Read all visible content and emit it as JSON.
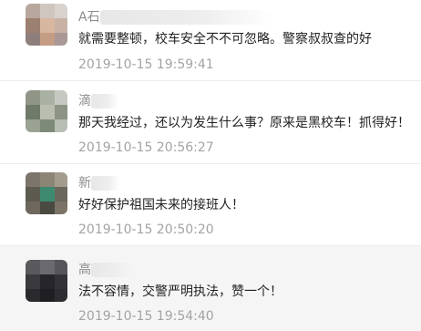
{
  "comments": [
    {
      "username": "A石",
      "text": "就需要整顿，校车安全不不可忽略。警察叔叔查的好",
      "timestamp": "2019-10-15 19:59:41"
    },
    {
      "username": "滴",
      "text": "那天我经过，还以为发生什么事？原来是黑校车！抓得好！",
      "timestamp": "2019-10-15 20:56:27"
    },
    {
      "username": "新",
      "text": "好好保护祖国未来的接班人！",
      "timestamp": "2019-10-15 20:50:20"
    },
    {
      "username": "高",
      "text": "法不容情，交警严明执法，赞一个！",
      "timestamp": "2019-10-15 19:54:40"
    }
  ],
  "colors": {
    "username": "#8c8c8c",
    "text": "#222222",
    "timestamp": "#a3a3a3",
    "divider": "#ececec",
    "highlight_row": "#f5f5f5"
  },
  "icons": {
    "avatar": "pixelated-avatar-icon"
  }
}
